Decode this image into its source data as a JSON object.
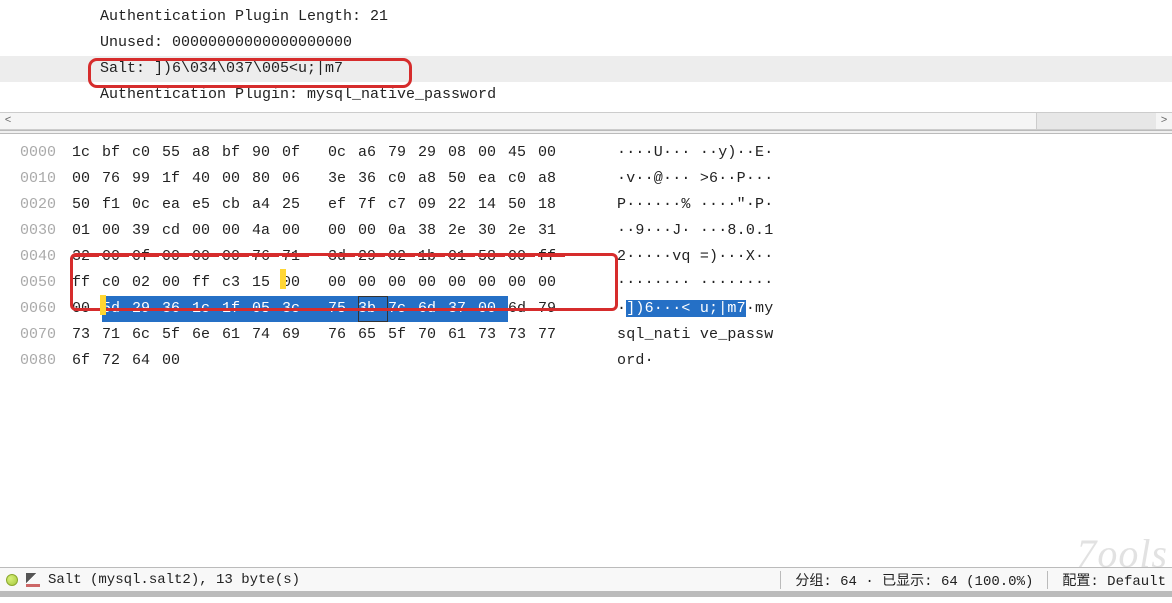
{
  "details": {
    "auth_plugin_length": "Authentication Plugin Length: 21",
    "unused": "Unused: 00000000000000000000",
    "salt": "Salt: ])6\\034\\037\\005<u;|m7",
    "auth_plugin": "Authentication Plugin: mysql_native_password"
  },
  "hex": {
    "rows": [
      {
        "offset": "0000",
        "bytes": [
          "1c",
          "bf",
          "c0",
          "55",
          "a8",
          "bf",
          "90",
          "0f",
          "0c",
          "a6",
          "79",
          "29",
          "08",
          "00",
          "45",
          "00"
        ],
        "ascii": "····U··· ··y)··E·"
      },
      {
        "offset": "0010",
        "bytes": [
          "00",
          "76",
          "99",
          "1f",
          "40",
          "00",
          "80",
          "06",
          "3e",
          "36",
          "c0",
          "a8",
          "50",
          "ea",
          "c0",
          "a8"
        ],
        "ascii": "·v··@··· >6··P···"
      },
      {
        "offset": "0020",
        "bytes": [
          "50",
          "f1",
          "0c",
          "ea",
          "e5",
          "cb",
          "a4",
          "25",
          "ef",
          "7f",
          "c7",
          "09",
          "22",
          "14",
          "50",
          "18"
        ],
        "ascii": "P······% ····\"·P·"
      },
      {
        "offset": "0030",
        "bytes": [
          "01",
          "00",
          "39",
          "cd",
          "00",
          "00",
          "4a",
          "00",
          "00",
          "00",
          "0a",
          "38",
          "2e",
          "30",
          "2e",
          "31"
        ],
        "ascii": "··9···J· ···8.0.1"
      },
      {
        "offset": "0040",
        "bytes": [
          "32",
          "00",
          "0f",
          "00",
          "00",
          "00",
          "76",
          "71",
          "3d",
          "29",
          "02",
          "1b",
          "01",
          "58",
          "00",
          "ff"
        ],
        "ascii": "2·····vq =)···X··"
      },
      {
        "offset": "0050",
        "bytes": [
          "ff",
          "c0",
          "02",
          "00",
          "ff",
          "c3",
          "15",
          "00",
          "00",
          "00",
          "00",
          "00",
          "00",
          "00",
          "00",
          "00"
        ],
        "ascii": "········ ········"
      },
      {
        "offset": "0060",
        "bytes": [
          "00",
          "5d",
          "29",
          "36",
          "1c",
          "1f",
          "05",
          "3c",
          "75",
          "3b",
          "7c",
          "6d",
          "37",
          "00",
          "6d",
          "79"
        ],
        "ascii_pre": "·",
        "ascii_sel": "])6···< u;|m7",
        "ascii_post": "·my"
      },
      {
        "offset": "0070",
        "bytes": [
          "73",
          "71",
          "6c",
          "5f",
          "6e",
          "61",
          "74",
          "69",
          "76",
          "65",
          "5f",
          "70",
          "61",
          "73",
          "73",
          "77"
        ],
        "ascii": "sql_nati ve_passw"
      },
      {
        "offset": "0080",
        "bytes": [
          "6f",
          "72",
          "64",
          "00",
          "",
          "",
          "",
          "",
          "",
          "",
          "",
          "",
          "",
          "",
          "",
          ""
        ],
        "ascii": "ord·"
      }
    ]
  },
  "status": {
    "field": "Salt (mysql.salt2), 13 byte(s)",
    "packets": "分组: 64 · 已显示: 64 (100.0%)",
    "profile": "配置: Default"
  },
  "watermark": "7ools"
}
